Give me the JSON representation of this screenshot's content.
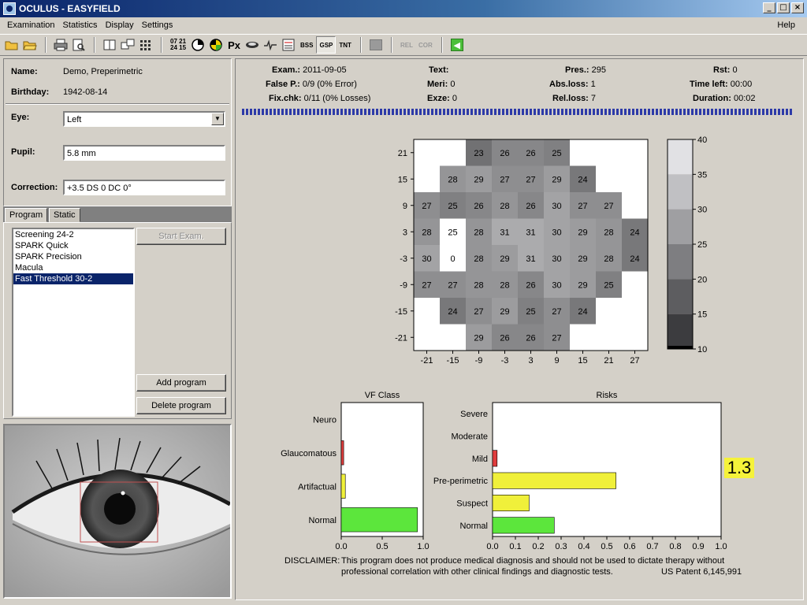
{
  "window": {
    "title": "OCULUS - EASYFIELD",
    "min": "_",
    "max": "□",
    "close": "×"
  },
  "menu": {
    "items": [
      "Examination",
      "Statistics",
      "Display",
      "Settings"
    ],
    "help": "Help"
  },
  "toolbar": {
    "labels": [
      "BSS",
      "GSP",
      "TNT"
    ],
    "gray_labels": [
      "REL",
      "COR"
    ],
    "px": "Px",
    "timer_top": "07 21",
    "timer_bottom": "24 15"
  },
  "patient": {
    "name_label": "Name:",
    "name": "Demo, Preperimetric",
    "birthday_label": "Birthday:",
    "birthday": "1942-08-14",
    "eye_label": "Eye:",
    "eye": "Left",
    "pupil_label": "Pupil:",
    "pupil": "5.8 mm",
    "correction_label": "Correction:",
    "correction": "+3.5 DS 0 DC 0°"
  },
  "tabs": [
    "Program",
    "Static"
  ],
  "programs": {
    "items": [
      "Screening 24-2",
      "SPARK Quick",
      "SPARK Precision",
      "Macula",
      "Fast Threshold 30-2"
    ],
    "selected_index": 4,
    "start": "Start Exam.",
    "add": "Add program",
    "delete": "Delete program"
  },
  "exam": {
    "exam_label": "Exam.:",
    "exam": "2011-09-05",
    "falsep_label": "False P.:",
    "falsep": "0/9 (0% Error)",
    "fixchk_label": "Fix.chk:",
    "fixchk": "0/11 (0% Losses)",
    "text_label": "Text:",
    "text": "",
    "meri_label": "Meri:",
    "meri": "0",
    "exze_label": "Exze:",
    "exze": "0",
    "pres_label": "Pres.:",
    "pres": "295",
    "absloss_label": "Abs.loss:",
    "absloss": "1",
    "relloss_label": "Rel.loss:",
    "relloss": "7",
    "rst_label": "Rst:",
    "rst": "0",
    "timeleft_label": "Time left:",
    "timeleft": "00:00",
    "duration_label": "Duration:",
    "duration": "00:02"
  },
  "chart_data": [
    {
      "type": "heatmap",
      "x": [
        -21,
        -15,
        -9,
        -3,
        3,
        9,
        15,
        21,
        27
      ],
      "y": [
        21,
        15,
        9,
        3,
        -3,
        -9,
        -15,
        -21
      ],
      "values": [
        [
          null,
          null,
          23,
          26,
          26,
          25,
          null,
          null,
          null
        ],
        [
          null,
          28,
          29,
          27,
          27,
          29,
          24,
          null,
          null
        ],
        [
          27,
          25,
          26,
          28,
          26,
          30,
          27,
          27,
          null
        ],
        [
          28,
          25,
          28,
          31,
          31,
          30,
          29,
          28,
          24
        ],
        [
          30,
          0,
          28,
          29,
          31,
          30,
          29,
          28,
          24
        ],
        [
          27,
          27,
          28,
          28,
          26,
          30,
          29,
          25,
          null
        ],
        [
          null,
          24,
          27,
          29,
          25,
          27,
          24,
          null,
          null
        ],
        [
          null,
          null,
          29,
          26,
          26,
          27,
          null,
          null,
          null
        ]
      ],
      "xlim": [
        -24,
        30
      ],
      "ylim": [
        -24,
        24
      ],
      "colorbar": {
        "ticks": [
          10,
          15,
          20,
          25,
          30,
          35,
          40
        ],
        "range": [
          10,
          40
        ]
      }
    },
    {
      "type": "bar",
      "title": "VF Class",
      "categories": [
        "Neuro",
        "Glaucomatous",
        "Artifactual",
        "Normal"
      ],
      "values": [
        0,
        0.03,
        0.05,
        0.93
      ],
      "colors": [
        "#e03c3c",
        "#e03c3c",
        "#f0f03a",
        "#5ce63c"
      ],
      "xlim": [
        0,
        1.0
      ],
      "xticks": [
        "0.0",
        "0.5",
        "1.0"
      ]
    },
    {
      "type": "bar",
      "title": "Risks",
      "categories": [
        "Severe",
        "Moderate",
        "Mild",
        "Pre-perimetric",
        "Suspect",
        "Normal"
      ],
      "values": [
        0,
        0,
        0.02,
        0.54,
        0.16,
        0.27
      ],
      "colors": [
        "#e03c3c",
        "#e03c3c",
        "#e03c3c",
        "#f0f03a",
        "#f0f03a",
        "#5ce63c"
      ],
      "xlim": [
        0,
        1.0
      ],
      "xticks": [
        "0.0",
        "0.1",
        "0.2",
        "0.3",
        "0.4",
        "0.5",
        "0.6",
        "0.7",
        "0.8",
        "0.9",
        "1.0"
      ],
      "score": "1.3"
    }
  ],
  "disclaimer": {
    "label": "DISCLAIMER:",
    "line1": "This program does not produce medical diagnosis and should not be used to dictate therapy without",
    "line2": "professional correlation with other clinical findings and diagnostic tests.",
    "patent": "US Patent 6,145,991"
  }
}
